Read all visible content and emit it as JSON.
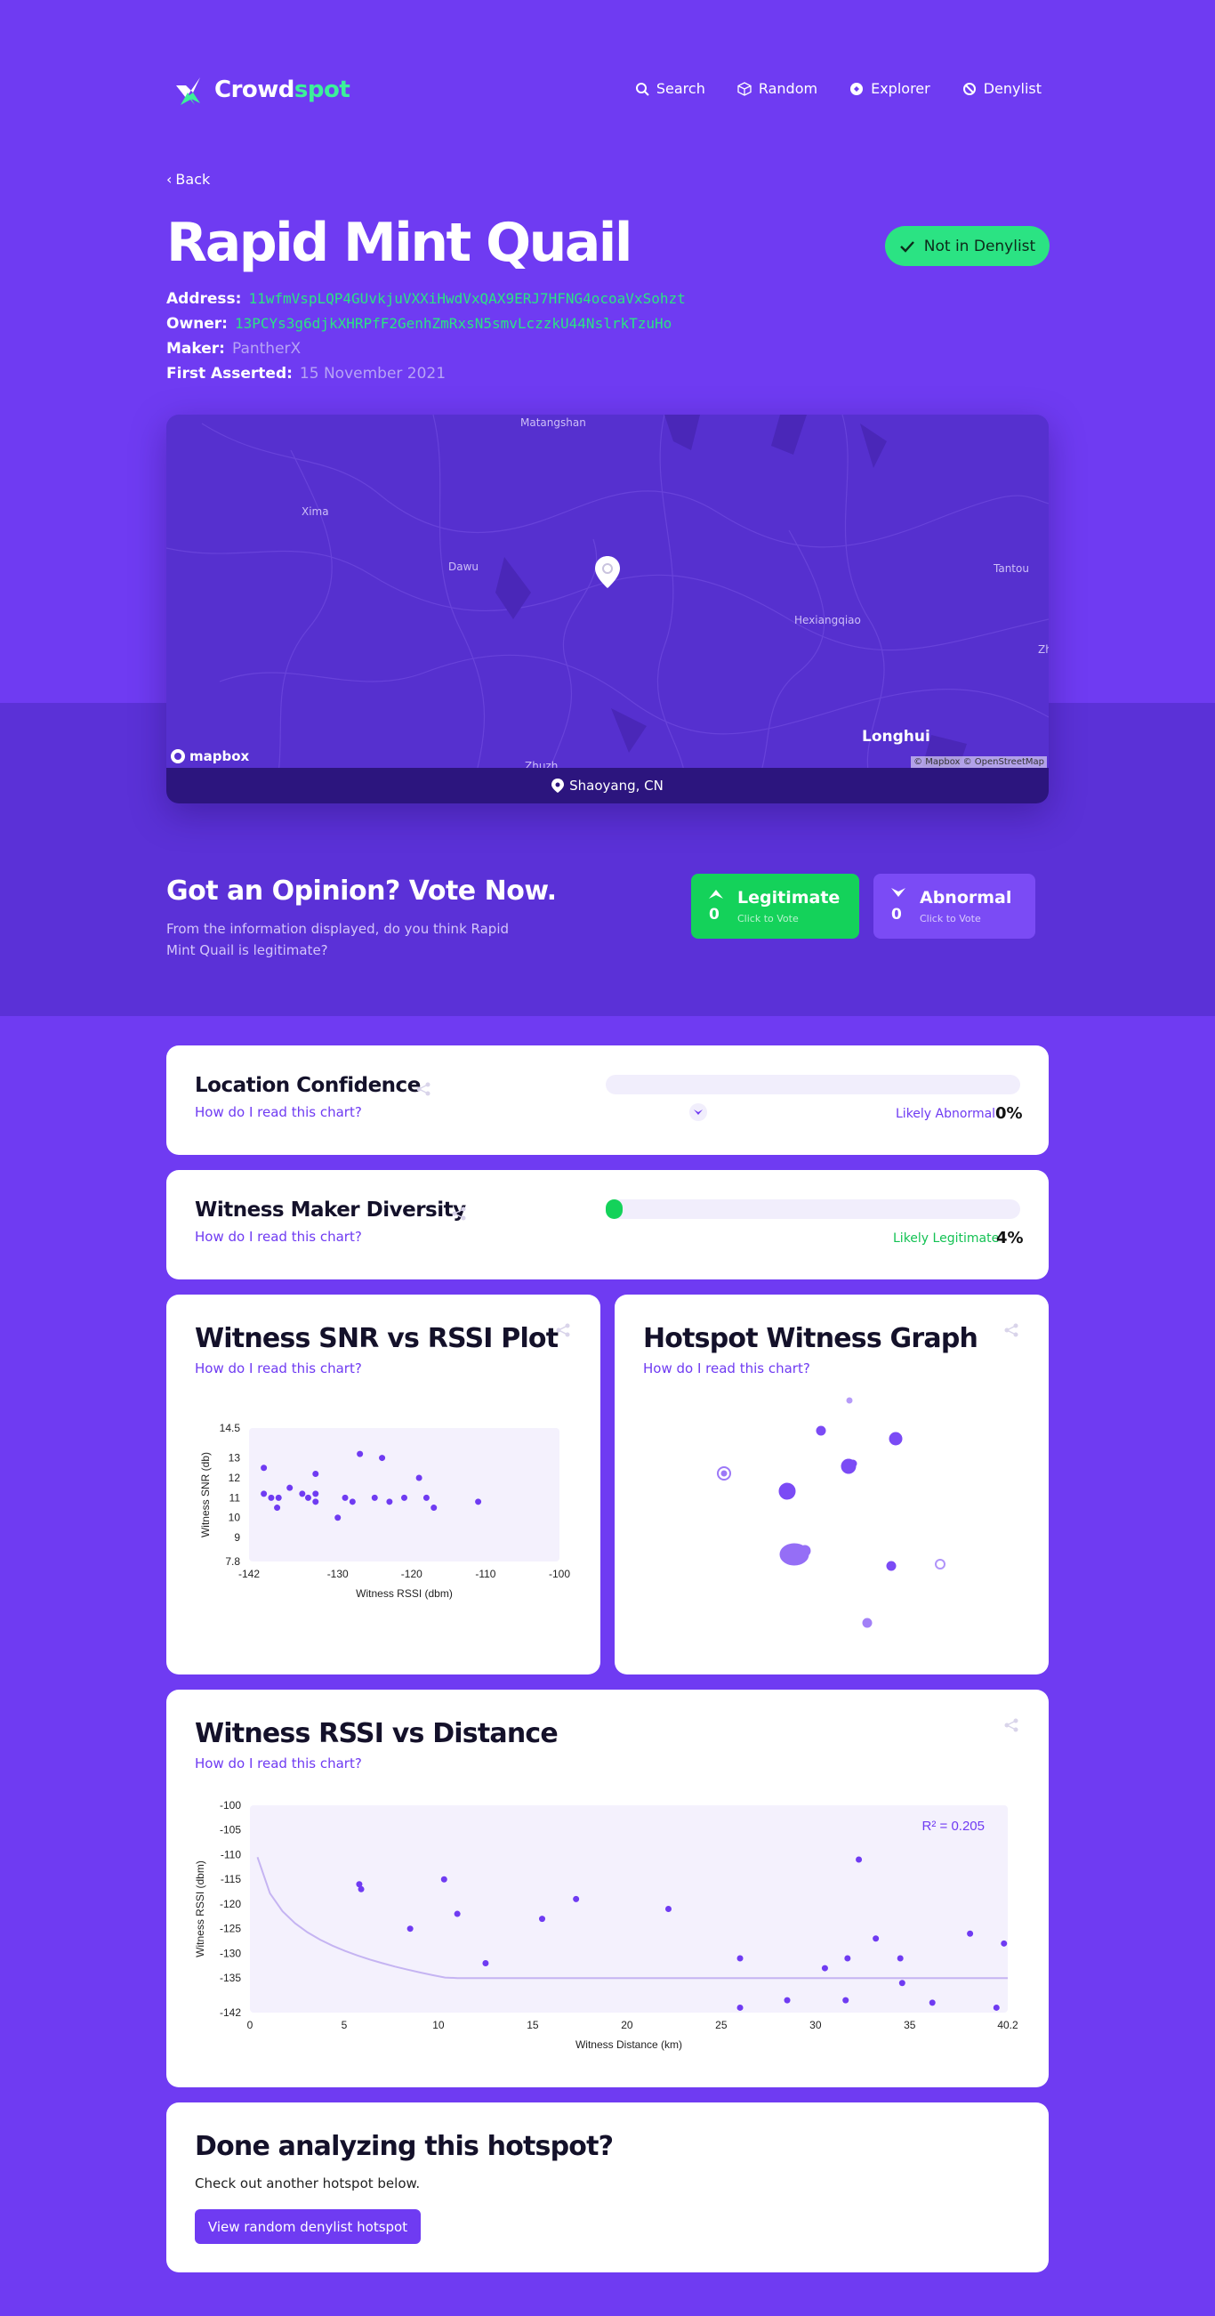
{
  "brand": {
    "name_main": "Crowd",
    "name_accent": "spot"
  },
  "nav": {
    "items": [
      {
        "label": "Search",
        "icon": "search-icon"
      },
      {
        "label": "Random",
        "icon": "cube-icon"
      },
      {
        "label": "Explorer",
        "icon": "explorer-icon"
      },
      {
        "label": "Denylist",
        "icon": "ban-icon"
      }
    ]
  },
  "back_label": "Back",
  "hotspot": {
    "name": "Rapid Mint Quail",
    "status": "Not in Denylist",
    "address_label": "Address:",
    "address": "11wfmVspLQP4GUvkjuVXXiHwdVxQAX9ERJ7HFNG4ocoaVxSohzt",
    "owner_label": "Owner:",
    "owner": "13PCYs3g6djkXHRPfF2GenhZmRxsN5smvLczzkU44NslrkTzuHo",
    "maker_label": "Maker:",
    "maker": "PantherX",
    "first_asserted_label": "First Asserted:",
    "first_asserted": "15 November 2021",
    "location": "Shaoyang, CN"
  },
  "map": {
    "labels": [
      "Matangshan",
      "Xima",
      "Dawu",
      "Tantou",
      "Hexiangqiao",
      "Zh",
      "Longhui",
      "Zhuzh"
    ],
    "brand": "mapbox",
    "attribution": "© Mapbox © OpenStreetMap"
  },
  "vote": {
    "title": "Got an Opinion? Vote Now.",
    "subtitle": "From the information displayed, do you think Rapid Mint Quail is legitimate?",
    "legit_label": "Legitimate",
    "legit_hint": "Click to Vote",
    "legit_count": "0",
    "abnormal_label": "Abnormal",
    "abnormal_hint": "Click to Vote",
    "abnormal_count": "0"
  },
  "how_to_read": "How do I read this chart?",
  "location_confidence": {
    "title": "Location Confidence",
    "status": "Likely Abnormal",
    "percent_label": "0%",
    "percent": 0
  },
  "maker_diversity": {
    "title": "Witness Maker Diversity",
    "status": "Likely Legitimate",
    "percent_label": "4%",
    "percent": 4
  },
  "snr_plot": {
    "title": "Witness SNR vs RSSI Plot"
  },
  "witness_graph": {
    "title": "Hotspot Witness Graph"
  },
  "rssi_distance": {
    "title": "Witness RSSI vs Distance",
    "r2_label": "R² = 0.205"
  },
  "done": {
    "title": "Done analyzing this hotspot?",
    "subtitle": "Check out another hotspot below.",
    "button": "View random denylist hotspot"
  },
  "colors": {
    "brand_purple": "#6F3BF2",
    "legit_green": "#14D25A",
    "abnormal_purple": "#7B4BF5",
    "hash_green": "#2BE383"
  },
  "chart_data": [
    {
      "type": "scatter",
      "title": "",
      "xlabel": "Witness RSSI (dbm)",
      "ylabel": "Witness SNR (db)",
      "xlim": [
        -142,
        -100
      ],
      "ylim": [
        7.8,
        14.5
      ],
      "x_ticks": [
        "-142",
        "-130",
        "-120",
        "-110",
        "-100"
      ],
      "y_ticks": [
        "14.5",
        "13",
        "12",
        "11",
        "10",
        "9",
        "7.8"
      ],
      "points": [
        [
          -140,
          12.5
        ],
        [
          -140,
          11.2
        ],
        [
          -139,
          11
        ],
        [
          -138,
          11
        ],
        [
          -138.2,
          10.5
        ],
        [
          -136.5,
          11.5
        ],
        [
          -134.8,
          11.2
        ],
        [
          -134,
          11
        ],
        [
          -133,
          12.2
        ],
        [
          -133,
          11.2
        ],
        [
          -133,
          10.8
        ],
        [
          -130,
          10
        ],
        [
          -129,
          11
        ],
        [
          -128,
          10.8
        ],
        [
          -127,
          13.2
        ],
        [
          -125,
          11
        ],
        [
          -124,
          13
        ],
        [
          -123,
          10.8
        ],
        [
          -121,
          11
        ],
        [
          -119,
          12
        ],
        [
          -118,
          11
        ],
        [
          -117,
          10.5
        ],
        [
          -111,
          10.8
        ]
      ]
    },
    {
      "type": "scatter",
      "title": "",
      "xlabel": "Witness Distance (km)",
      "ylabel": "Witness RSSI (dbm)",
      "xlim": [
        0,
        40.2
      ],
      "ylim": [
        -142,
        -100
      ],
      "x_ticks": [
        "0",
        "5",
        "10",
        "15",
        "20",
        "25",
        "30",
        "35",
        "40.2"
      ],
      "y_ticks": [
        "-100",
        "-105",
        "-110",
        "-115",
        "-120",
        "-125",
        "-130",
        "-135",
        "-142"
      ],
      "annotation": "R² = 0.205",
      "points": [
        [
          5.8,
          -116
        ],
        [
          5.9,
          -117
        ],
        [
          8.5,
          -125
        ],
        [
          10.3,
          -115
        ],
        [
          11,
          -122
        ],
        [
          12.5,
          -132
        ],
        [
          15.5,
          -123
        ],
        [
          17.3,
          -119
        ],
        [
          22.2,
          -121
        ],
        [
          26,
          -131
        ],
        [
          26,
          -141
        ],
        [
          28.5,
          -139.5
        ],
        [
          30.5,
          -133
        ],
        [
          31.6,
          -139.5
        ],
        [
          31.7,
          -131
        ],
        [
          32.3,
          -111
        ],
        [
          33.2,
          -127
        ],
        [
          34.5,
          -131
        ],
        [
          34.6,
          -136
        ],
        [
          36.2,
          -140
        ],
        [
          38.2,
          -126
        ],
        [
          39.6,
          -141
        ],
        [
          40,
          -128
        ]
      ]
    }
  ]
}
